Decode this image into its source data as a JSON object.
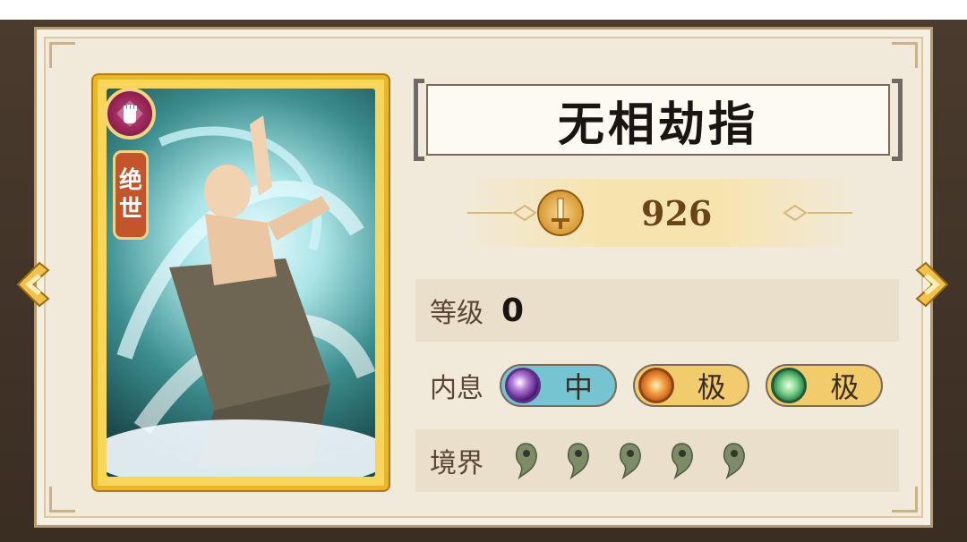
{
  "skill": {
    "title": "无相劫指",
    "rarity_tag": [
      "绝",
      "世"
    ],
    "power": "926"
  },
  "stats": {
    "level_label": "等级",
    "level_value": "0",
    "neixi_label": "内息",
    "neixi": [
      {
        "label": "中",
        "orb": "purple-moon-orb",
        "color": "#76c3d2"
      },
      {
        "label": "极",
        "orb": "orange-sun-orb",
        "color": "#f1cb6c"
      },
      {
        "label": "极",
        "orb": "green-moon-orb",
        "color": "#f1cb6c"
      }
    ],
    "realm_label": "境界",
    "realm_marks": 5
  },
  "colors": {
    "card_border": "#e9b627",
    "panel_bg": "#f1eadb",
    "realm_mark": "#7d8c66"
  }
}
